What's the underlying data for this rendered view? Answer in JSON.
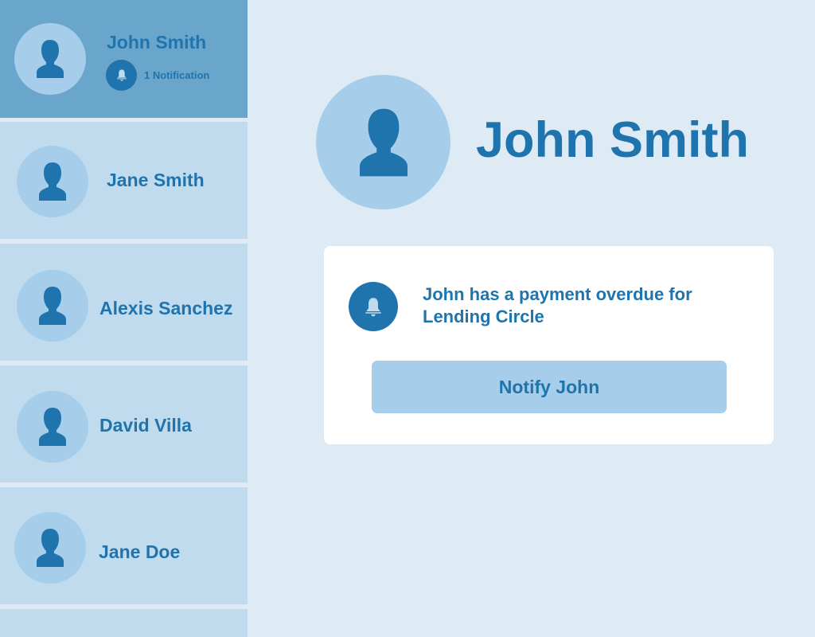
{
  "sidebar": {
    "contacts": [
      {
        "name": "John Smith",
        "active": true,
        "notification_label": "1 Notification"
      },
      {
        "name": "Jane Smith",
        "active": false
      },
      {
        "name": "Alexis Sanchez",
        "active": false
      },
      {
        "name": "David Villa",
        "active": false
      },
      {
        "name": "Jane Doe",
        "active": false
      }
    ]
  },
  "profile": {
    "name": "John Smith"
  },
  "notification_card": {
    "message": "John has a payment overdue for Lending Circle",
    "button_label": "Notify John"
  },
  "icons": {
    "avatar": "person-silhouette-icon",
    "notification": "bell-icon"
  },
  "colors": {
    "page_background": "#deebf5",
    "sidebar_item": "#c1dbee",
    "sidebar_item_active": "#6aa6cb",
    "avatar_background": "#a6cde9",
    "accent": "#1f74ad",
    "card_background": "#ffffff",
    "button_background": "#a6cde9"
  }
}
